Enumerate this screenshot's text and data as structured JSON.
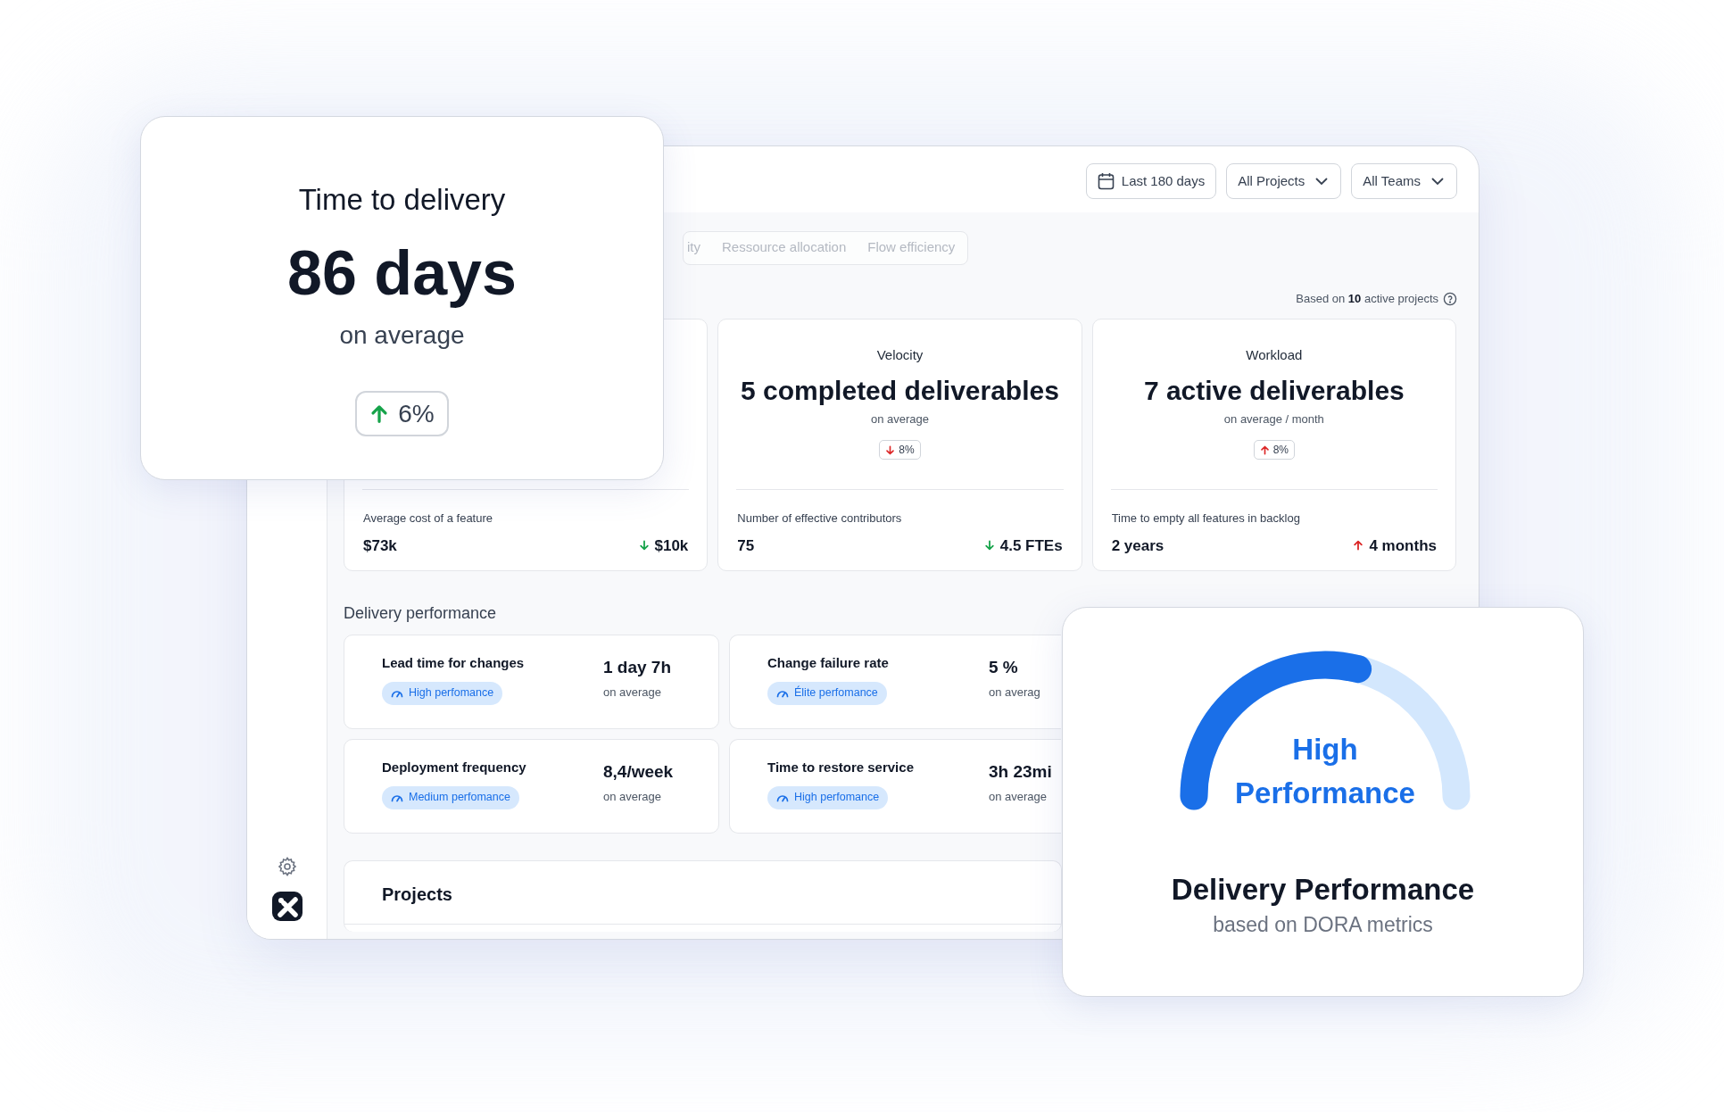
{
  "filters": [
    {
      "kind": "date",
      "label": "Last 180 days"
    },
    {
      "kind": "dropdown",
      "label": "All Projects"
    },
    {
      "kind": "dropdown",
      "label": "All Teams"
    }
  ],
  "tabs": [
    {
      "label": "ity"
    },
    {
      "label": "Ressource allocation"
    },
    {
      "label": "Flow efficiency"
    }
  ],
  "basis_note": "Based on **10** active projects",
  "metric_cards": [
    {
      "footer_label": "Average cost of a feature",
      "footer_value": "$73k",
      "footer_change": {
        "rising": false,
        "good": true,
        "text": "$10k"
      }
    },
    {
      "title": "Velocity",
      "value": "5 completed deliverables",
      "subtitle": "on average",
      "change": {
        "rising": false,
        "good": false,
        "text": "8%"
      },
      "footer_label": "Number of effective contributors",
      "footer_value": "75",
      "footer_change": {
        "rising": false,
        "good": true,
        "text": "4.5 FTEs"
      }
    },
    {
      "title": "Workload",
      "value": "7 active deliverables",
      "subtitle": "on average / month",
      "change": {
        "rising": true,
        "good": false,
        "text": "8%"
      },
      "footer_label": "Time to empty all features in backlog",
      "footer_value": "2 years",
      "footer_change": {
        "rising": true,
        "good": false,
        "text": "4 months"
      }
    }
  ],
  "section_title": "Delivery performance",
  "dora": [
    {
      "name": "Lead time for changes",
      "badge": "High perfomance",
      "value": "1 day 7h",
      "note": "on average"
    },
    {
      "name": "Change failure rate",
      "badge": "Élite perfomance",
      "value": "5 %",
      "note": "on averag"
    },
    {
      "name": "Deployment frequency",
      "badge": "Medium perfomance",
      "value": "8,4/week",
      "note": "on average"
    },
    {
      "name": "Time to restore service",
      "badge": "High perfomance",
      "value": "3h 23mi",
      "note": "on average"
    }
  ],
  "projects_title": "Projects",
  "time_card": {
    "title": "Time to delivery",
    "value": "86 days",
    "subtitle": "on average",
    "change": {
      "rising": true,
      "good": true,
      "text": "6%"
    }
  },
  "gauge_card": {
    "level": 0.58,
    "label": "High Performance",
    "title": "Delivery Performance",
    "subtitle": "based on DORA metrics"
  }
}
